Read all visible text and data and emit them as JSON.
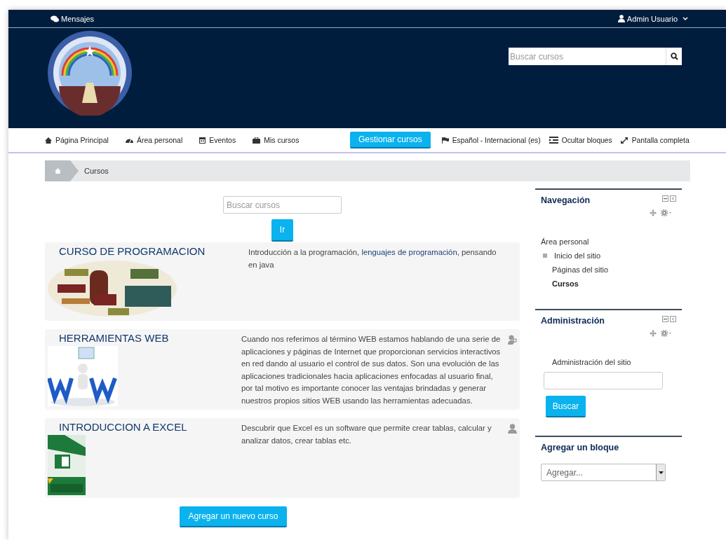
{
  "top_bar": {
    "messages": "Mensajes",
    "user": "Admin Usuario"
  },
  "header": {
    "search": {
      "placeholder": "Buscar cursos"
    }
  },
  "nav": {
    "items": [
      {
        "label": "Página Principal"
      },
      {
        "label": "Área personal"
      },
      {
        "label": "Eventos"
      },
      {
        "label": "Mis cursos"
      }
    ],
    "manage_button": "Gestionar cursos",
    "right_items": [
      {
        "label": "Español - Internacional (es)"
      },
      {
        "label": "Ocultar bloques"
      },
      {
        "label": "Pantalla completa"
      }
    ]
  },
  "breadcrumb": [
    "Cursos"
  ],
  "course_search": {
    "placeholder": "Buscar cursos",
    "button": "Ir"
  },
  "courses": [
    {
      "title": "CURSO DE PROGRAMACION",
      "description": [
        {
          "kind": "text",
          "text": "Introducción a la programación, "
        },
        {
          "kind": "link",
          "text": "lenguajes de programación"
        },
        {
          "kind": "text",
          "text": ", pensando en java"
        }
      ]
    },
    {
      "title": "HERRAMIENTAS WEB",
      "description": [
        {
          "kind": "text",
          "text": "Cuando nos referimos al término WEB estamos hablando de  una serie de aplicaciones y páginas de Internet que proporcionan servicios interactivos en red dando al usuario el control de sus datos. Son una evolución de las aplicaciones tradicionales hacia aplicaciones  enfocadas al usuario final, por tal motivo es importante conocer las ventajas brindadas y generar nuestros propios sitios WEB usando las herramientas adecuadas."
        }
      ]
    },
    {
      "title": "INTRODUCCION A EXCEL",
      "description": [
        {
          "kind": "text",
          "text": "Descubrir que Excel es un software que permite crear tablas, calcular y analizar datos, crear tablas etc."
        }
      ]
    }
  ],
  "add_course_button": "Agregar un nuevo curso",
  "blocks": {
    "navigation": {
      "title": "Navegación",
      "items": [
        {
          "label": "Área personal",
          "selected": false
        },
        {
          "label": "Inicio del sitio",
          "selected": false,
          "children": [
            {
              "label": "Páginas del sitio",
              "selected": false
            },
            {
              "label": "Cursos",
              "selected": true
            }
          ]
        }
      ]
    },
    "administration": {
      "title": "Administración",
      "item": "Administración del sitio",
      "button": "Buscar"
    },
    "add_block": {
      "title": "Agregar un bloque",
      "select": "Agregar..."
    }
  }
}
